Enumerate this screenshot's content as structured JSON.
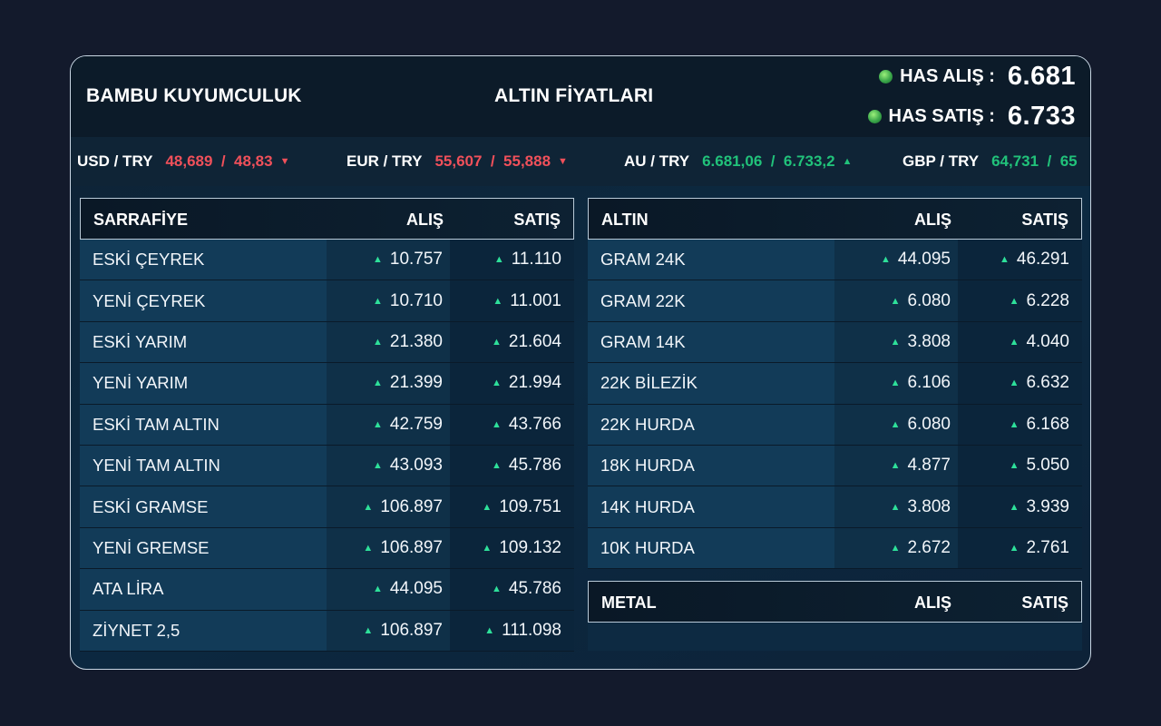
{
  "header": {
    "brand": "BAMBU KUYUMCULUK",
    "title": "ALTIN FİYATLARI",
    "has_alis_label": "HAS ALIŞ :",
    "has_alis_value": "6.681",
    "has_satis_label": "HAS SATIŞ :",
    "has_satis_value": "6.733"
  },
  "ticker": [
    {
      "pair": "USD / TRY",
      "values": "48,689  /  48,83",
      "trend": "down"
    },
    {
      "pair": "EUR / TRY",
      "values": "55,607  /  55,888",
      "trend": "down"
    },
    {
      "pair": "AU / TRY",
      "values": "6.681,06  /  6.733,2",
      "trend": "up"
    },
    {
      "pair": "GBP / TRY",
      "values": "64,731  /  65",
      "trend": "up"
    }
  ],
  "sarrafiye": {
    "title": "SARRAFİYE",
    "col_alis": "ALIŞ",
    "col_satis": "SATIŞ",
    "rows": [
      {
        "name": "ESKİ ÇEYREK",
        "alis": "10.757",
        "satis": "11.110"
      },
      {
        "name": "YENİ ÇEYREK",
        "alis": "10.710",
        "satis": "11.001"
      },
      {
        "name": "ESKİ YARIM",
        "alis": "21.380",
        "satis": "21.604"
      },
      {
        "name": "YENİ YARIM",
        "alis": "21.399",
        "satis": "21.994"
      },
      {
        "name": "ESKİ TAM ALTIN",
        "alis": "42.759",
        "satis": "43.766"
      },
      {
        "name": "YENİ TAM ALTIN",
        "alis": "43.093",
        "satis": "45.786"
      },
      {
        "name": "ESKİ GRAMSE",
        "alis": "106.897",
        "satis": "109.751"
      },
      {
        "name": "YENİ GREMSE",
        "alis": "106.897",
        "satis": "109.132"
      },
      {
        "name": "ATA LİRA",
        "alis": "44.095",
        "satis": "45.786"
      },
      {
        "name": "ZİYNET 2,5",
        "alis": "106.897",
        "satis": "111.098"
      }
    ]
  },
  "altin": {
    "title": "ALTIN",
    "col_alis": "ALIŞ",
    "col_satis": "SATIŞ",
    "rows": [
      {
        "name": "GRAM 24K",
        "alis": "44.095",
        "satis": "46.291"
      },
      {
        "name": "GRAM 22K",
        "alis": "6.080",
        "satis": "6.228"
      },
      {
        "name": "GRAM 14K",
        "alis": "3.808",
        "satis": "4.040"
      },
      {
        "name": "22K BİLEZİK",
        "alis": "6.106",
        "satis": "6.632"
      },
      {
        "name": "22K HURDA",
        "alis": "6.080",
        "satis": "6.168"
      },
      {
        "name": "18K HURDA",
        "alis": "4.877",
        "satis": "5.050"
      },
      {
        "name": "14K HURDA",
        "alis": "3.808",
        "satis": "3.939"
      },
      {
        "name": "10K HURDA",
        "alis": "2.672",
        "satis": "2.761"
      }
    ]
  },
  "metal": {
    "title": "METAL",
    "col_alis": "ALIŞ",
    "col_satis": "SATIŞ"
  },
  "colors": {
    "up": "#21c27a",
    "down": "#f0505a",
    "background": "#131a2c"
  },
  "icons": {
    "up": "triangle-up-icon",
    "down": "triangle-down-icon",
    "status": "green-dot-icon"
  }
}
